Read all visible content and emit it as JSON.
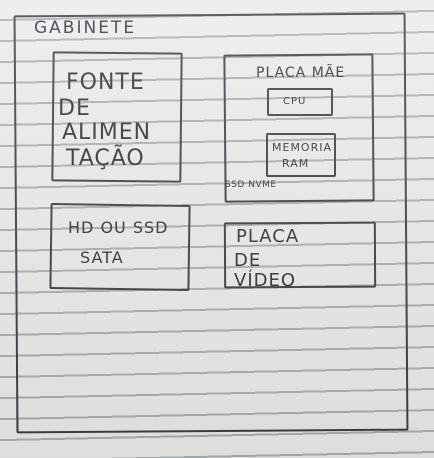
{
  "gabinete": {
    "title": "GABINETE"
  },
  "fonte": {
    "lines": [
      "FONTE",
      "DE",
      "ALIMEN",
      "TAÇÃO"
    ]
  },
  "placa_mae": {
    "title": "PLACA MÃE",
    "cpu": "CPU",
    "ram": [
      "MEMORIA",
      "RAM"
    ],
    "ssd": "SSD NVME"
  },
  "hd": {
    "lines": [
      "HD OU SSD",
      "SATA"
    ]
  },
  "placa_video": {
    "lines": [
      "PLACA",
      "DE",
      "VÍDEO"
    ]
  },
  "colors": {
    "ink": "#2f2f38",
    "paper": "#ebebe9",
    "rule": "#a8b0b6"
  }
}
